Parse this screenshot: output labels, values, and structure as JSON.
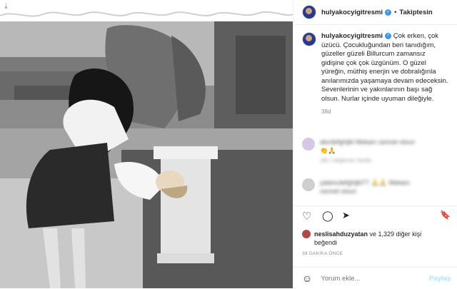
{
  "post": {
    "username": "hulyakocyigitresmi",
    "follow_label": "Takiptesin",
    "dot": "•",
    "caption_user": "hulyakocyigitresmi",
    "caption_text": " Çok erken, çok üzücü. Çocukluğundan beri tanıdığım, güzeller güzeli Billurcum zamansız gidişine çok çok üzgünüm. O güzel yüreğin, müthiş enerjin ve dobralığınla anılarımızda yaşamaya devam edeceksin. Sevenlerinin ve yakınlarının başı sağ olsun. Nurlar içinde uyuman dileğiyle.",
    "caption_age": "38d"
  },
  "comments": [
    {
      "text_line1": "abcdefghijkl Mekanı cennet olsun",
      "text_line2": "👏🙏",
      "meta": "18h 1 beğenme Yanıtla"
    },
    {
      "text_line1": "yalancdefghijkl77 🙏🙏 Mekanı",
      "text_line2": "cennet olsun",
      "meta": ""
    }
  ],
  "icons": {
    "download": "download-icon",
    "heart": "♡",
    "comment": "◯",
    "share": "➤",
    "save": "🔖",
    "emoji": "☺",
    "small_heart": "♡"
  },
  "likes": {
    "user": "neslisahduzyatan",
    "rest": " ve 1,329 diğer kişi",
    "line2": "beğendi"
  },
  "timestamp": "38 DAKİKA ÖNCE",
  "add_comment": {
    "placeholder": "Yorum ekle...",
    "post_label": "Paylaş"
  }
}
